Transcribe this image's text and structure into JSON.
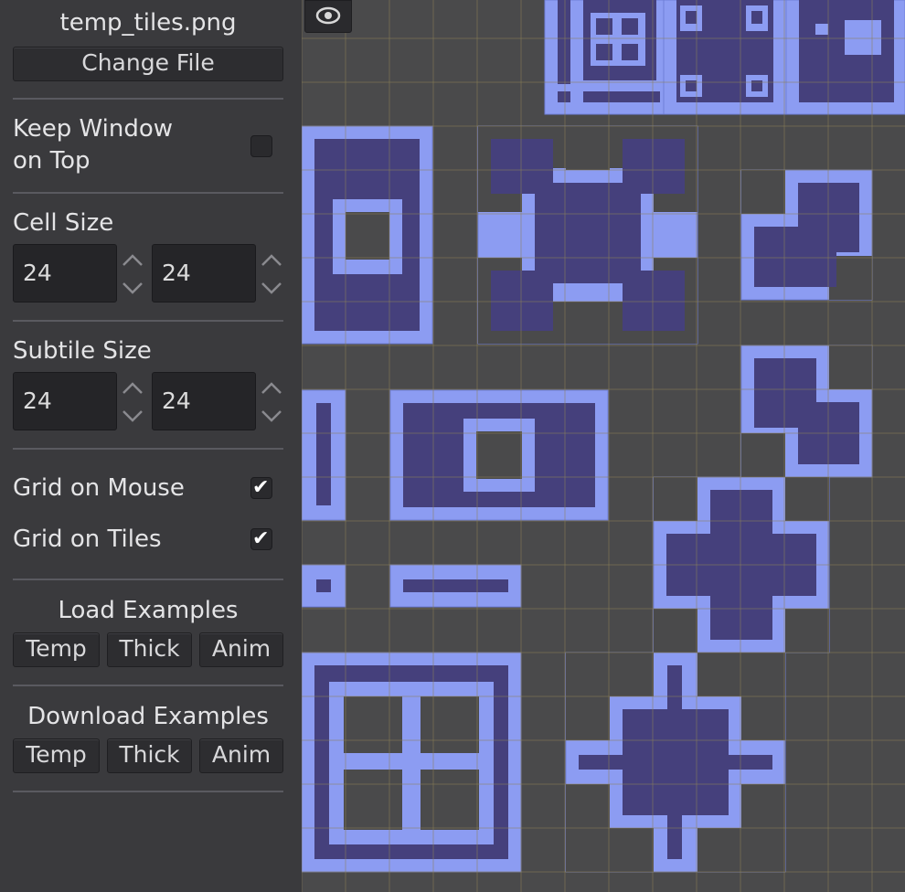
{
  "sidebar": {
    "file_name": "temp_tiles.png",
    "change_file": "Change File",
    "keep_window_line1": "Keep Window",
    "keep_window_line2": "on Top",
    "keep_window_checked": false,
    "cell_size_label": "Cell Size",
    "cell_size_x": "24",
    "cell_size_y": "24",
    "subtile_size_label": "Subtile Size",
    "subtile_size_x": "24",
    "subtile_size_y": "24",
    "grid_on_mouse_label": "Grid on Mouse",
    "grid_on_mouse_checked": true,
    "grid_on_tiles_label": "Grid on Tiles",
    "grid_on_tiles_checked": true,
    "load_examples_label": "Load Examples",
    "load_buttons": [
      "Temp",
      "Thick",
      "Anim"
    ],
    "download_examples_label": "Download Examples",
    "download_buttons": [
      "Temp",
      "Thick",
      "Anim"
    ]
  },
  "canvas": {
    "toggle_icon": "eye-icon"
  },
  "colors": {
    "sidebar_bg": "#3a3a3d",
    "canvas_bg": "#4a4a4b",
    "tile_light": "#8c9cf2",
    "tile_dark": "#45407c",
    "grid_line": "#7a7055"
  }
}
